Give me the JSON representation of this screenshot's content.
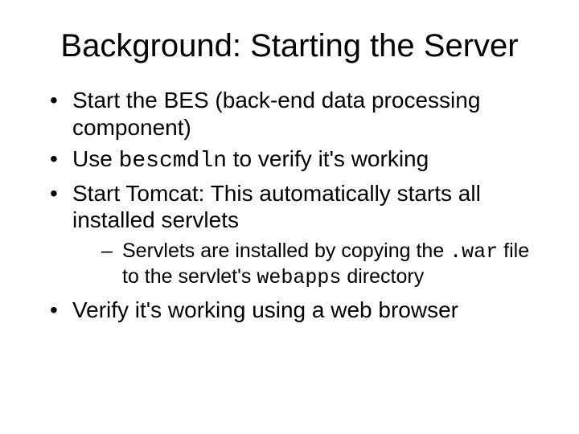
{
  "title": "Background: Starting the Server",
  "bullets": {
    "b1": "Start the BES (back-end data processing component)",
    "b2a": "Use ",
    "b2code": "bescmdln",
    "b2b": " to verify it's working",
    "b3": "Start Tomcat: This automatically starts all installed servlets",
    "b3s1a": "Servlets are installed by copying the ",
    "b3s1code1": ".war",
    "b3s1b": " file to the servlet's ",
    "b3s1code2": "webapps",
    "b3s1c": " directory",
    "b4": "Verify it's working using a web browser"
  }
}
